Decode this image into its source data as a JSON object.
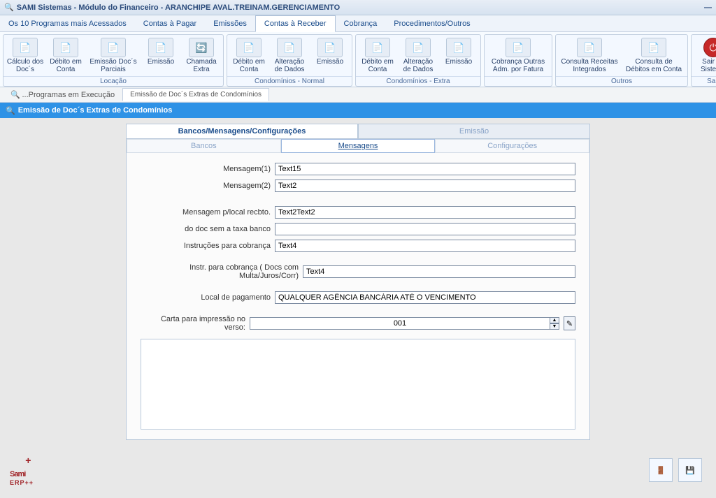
{
  "window": {
    "title": "SAMI Sistemas - Módulo do Financeiro - ARANCHIPE AVAL.TREINAM.GERENCIAMENTO"
  },
  "menubar": {
    "items": [
      "Os 10 Programas mais Acessados",
      "Contas à Pagar",
      "Emissões",
      "Contas à Receber",
      "Cobrança",
      "Procedimentos/Outros"
    ],
    "active_index": 3
  },
  "ribbon": {
    "groups": [
      {
        "caption": "Locação",
        "items": [
          {
            "label": "Cálculo dos Doc´s"
          },
          {
            "label": "Débito em Conta"
          },
          {
            "label": "Emissão Doc´s Parciais"
          },
          {
            "label": "Emissão"
          },
          {
            "label": "Chamada Extra"
          }
        ]
      },
      {
        "caption": "Condomínios - Normal",
        "items": [
          {
            "label": "Débito em Conta"
          },
          {
            "label": "Alteração de Dados"
          },
          {
            "label": "Emissão"
          }
        ]
      },
      {
        "caption": "Condomínios - Extra",
        "items": [
          {
            "label": "Débito em Conta"
          },
          {
            "label": "Alteração de Dados"
          },
          {
            "label": "Emissão"
          }
        ]
      },
      {
        "caption": "",
        "items": [
          {
            "label": "Cobrança Outras Adm. por Fatura"
          }
        ]
      },
      {
        "caption": "Outros",
        "items": [
          {
            "label": "Consulta Receitas Integrados"
          },
          {
            "label": "Consulta de Débitos em Conta"
          }
        ]
      },
      {
        "caption": "Sair",
        "items": [
          {
            "label": "Sair do Sistema",
            "icon": "power"
          }
        ]
      }
    ]
  },
  "doctabs": {
    "items": [
      "...Programas em Execução",
      "Emissão de Doc´s Extras de Condomínios"
    ],
    "active_index": 1
  },
  "section_title": "Emissão de Doc´s Extras de Condomínios",
  "maintabs": {
    "items": [
      "Bancos/Mensagens/Configurações",
      "Emissão"
    ],
    "active_index": 0
  },
  "subtabs": {
    "items": [
      "Bancos",
      "Mensagens",
      "Configurações"
    ],
    "active_index": 1
  },
  "form": {
    "labels": {
      "mensagem1": "Mensagem(1)",
      "mensagem2": "Mensagem(2)",
      "msg_local": "Mensagem p/local recbto.",
      "sem_taxa": "do doc sem a taxa banco",
      "instr_cobranca": "Instruções para cobrança",
      "instr_multa": "Instr. para cobrança ( Docs com Multa/Juros/Corr)",
      "local_pag": "Local de pagamento",
      "carta": "Carta para impressão no verso:"
    },
    "values": {
      "mensagem1": "Text15",
      "mensagem2": "Text2",
      "msg_local": "Text2Text2",
      "sem_taxa": "",
      "instr_cobranca": "Text4",
      "instr_multa": "Text4",
      "local_pag": "QUALQUER AGÊNCIA BANCÁRIA ATÉ O VENCIMENTO",
      "carta": "001"
    }
  },
  "logo": {
    "text": "Sami",
    "sub": "ERP++"
  }
}
